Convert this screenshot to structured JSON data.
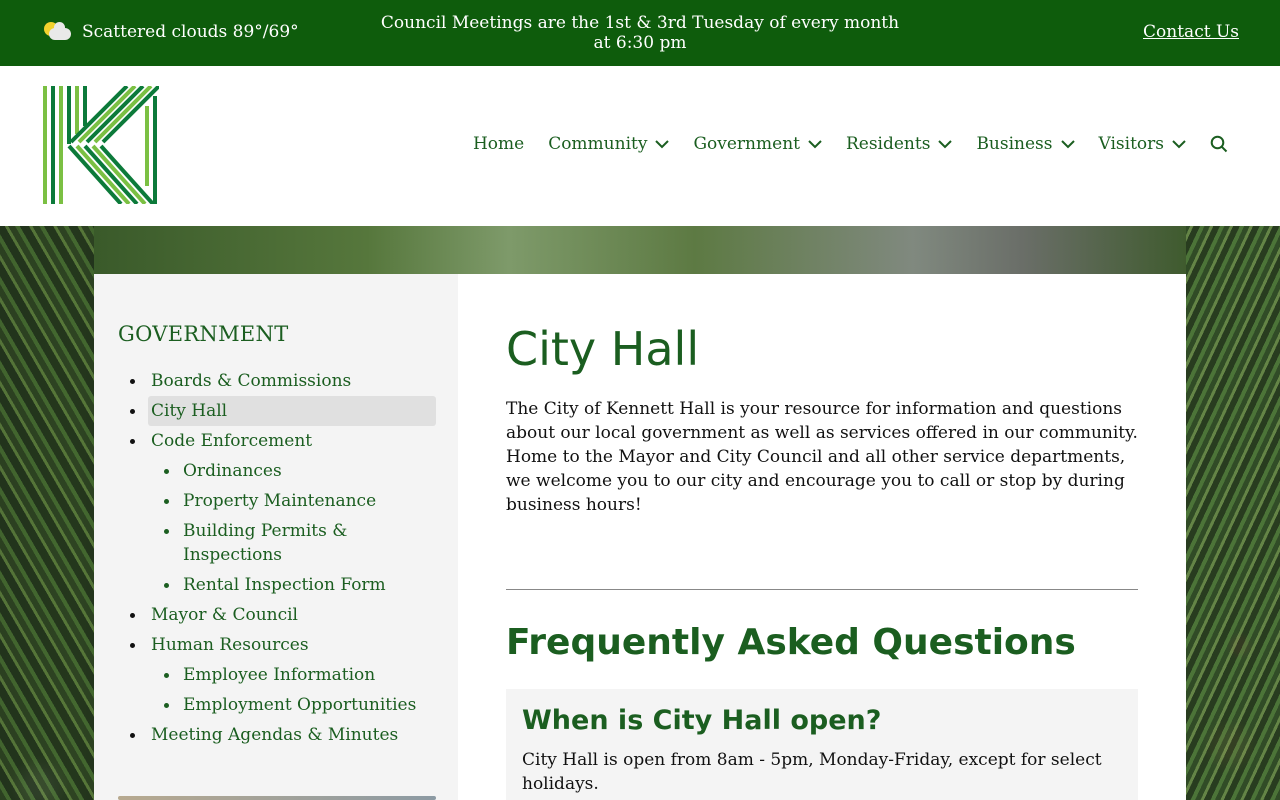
{
  "topbar": {
    "weather_text": "Scattered clouds 89°/69°",
    "announcement": "Council Meetings are the 1st & 3rd Tuesday of every month at 6:30 pm",
    "contact_label": "Contact Us"
  },
  "brand": {
    "accent": "#0e5c0c",
    "link": "#1b5e20"
  },
  "nav": {
    "items": [
      {
        "label": "Home"
      },
      {
        "label": "Community"
      },
      {
        "label": "Government"
      },
      {
        "label": "Residents"
      },
      {
        "label": "Business"
      },
      {
        "label": "Visitors"
      }
    ],
    "search_icon": "search-icon"
  },
  "sidebar": {
    "title": "GOVERNMENT",
    "items": [
      {
        "label": "Boards & Commissions"
      },
      {
        "label": "City Hall"
      },
      {
        "label": "Code Enforcement"
      },
      {
        "label": "Ordinances"
      },
      {
        "label": "Property Maintenance"
      },
      {
        "label": "Building Permits & Inspections"
      },
      {
        "label": "Rental Inspection Form"
      },
      {
        "label": "Mayor & Council"
      },
      {
        "label": "Human Resources"
      },
      {
        "label": "Employee Information"
      },
      {
        "label": "Employment Opportunities"
      },
      {
        "label": "Meeting Agendas & Minutes"
      }
    ]
  },
  "main": {
    "title": "City Hall",
    "intro": "The City of Kennett Hall is your resource for information and questions about our local government as well as services offered in our community. Home to the Mayor and City Council and all other service departments, we welcome you to our city and encourage you to call or stop by during business hours!",
    "faq_title": "Frequently Asked Questions",
    "faq": [
      {
        "question": "When is City Hall open?",
        "answer": "City Hall is open from 8am - 5pm, Monday-Friday, except for select holidays."
      }
    ]
  }
}
